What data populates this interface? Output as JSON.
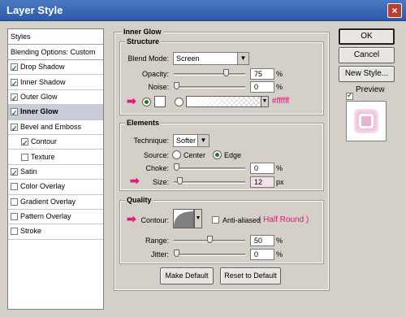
{
  "window": {
    "title": "Layer Style",
    "close_glyph": "×"
  },
  "styles_list": {
    "header": "Styles",
    "blending_options": "Blending Options: Custom",
    "items": [
      {
        "label": "Drop Shadow",
        "checked": true,
        "indent": false,
        "selected": false
      },
      {
        "label": "Inner Shadow",
        "checked": true,
        "indent": false,
        "selected": false
      },
      {
        "label": "Outer Glow",
        "checked": true,
        "indent": false,
        "selected": false
      },
      {
        "label": "Inner Glow",
        "checked": true,
        "indent": false,
        "selected": true
      },
      {
        "label": "Bevel and Emboss",
        "checked": true,
        "indent": false,
        "selected": false
      },
      {
        "label": "Contour",
        "checked": true,
        "indent": true,
        "selected": false
      },
      {
        "label": "Texture",
        "checked": false,
        "indent": true,
        "selected": false
      },
      {
        "label": "Satin",
        "checked": true,
        "indent": false,
        "selected": false
      },
      {
        "label": "Color Overlay",
        "checked": false,
        "indent": false,
        "selected": false
      },
      {
        "label": "Gradient Overlay",
        "checked": false,
        "indent": false,
        "selected": false
      },
      {
        "label": "Pattern Overlay",
        "checked": false,
        "indent": false,
        "selected": false
      },
      {
        "label": "Stroke",
        "checked": false,
        "indent": false,
        "selected": false
      }
    ]
  },
  "inner_glow": {
    "title": "Inner Glow",
    "structure": {
      "title": "Structure",
      "blend_mode_label": "Blend Mode:",
      "blend_mode_value": "Screen",
      "opacity_label": "Opacity:",
      "opacity_value": "75",
      "opacity_unit": "%",
      "opacity_level": 75,
      "noise_label": "Noise:",
      "noise_value": "0",
      "noise_unit": "%",
      "noise_level": 0,
      "color_note": "#ffffff"
    },
    "elements": {
      "title": "Elements",
      "technique_label": "Technique:",
      "technique_value": "Softer",
      "source_label": "Source:",
      "source_center": "Center",
      "source_edge": "Edge",
      "choke_label": "Choke:",
      "choke_value": "0",
      "choke_unit": "%",
      "choke_level": 0,
      "size_label": "Size:",
      "size_value": "12",
      "size_unit": "px",
      "size_level": 12
    },
    "quality": {
      "title": "Quality",
      "contour_label": "Contour:",
      "anti_aliased_label": "Anti-aliased",
      "contour_note": "( Half Round )",
      "range_label": "Range:",
      "range_value": "50",
      "range_unit": "%",
      "range_level": 50,
      "jitter_label": "Jitter:",
      "jitter_value": "0",
      "jitter_unit": "%",
      "jitter_level": 0
    },
    "make_default": "Make Default",
    "reset_default": "Reset to Default"
  },
  "buttons": {
    "ok": "OK",
    "cancel": "Cancel",
    "new_style": "New Style...",
    "preview": "Preview"
  },
  "colors": {
    "accent_pink": "#e6167a",
    "titlebar": "#2e5aa8",
    "selected_row": "#c8ccd8"
  },
  "icons": {
    "arrow": "pink-arrow-icon",
    "check": "checkmark-icon"
  }
}
